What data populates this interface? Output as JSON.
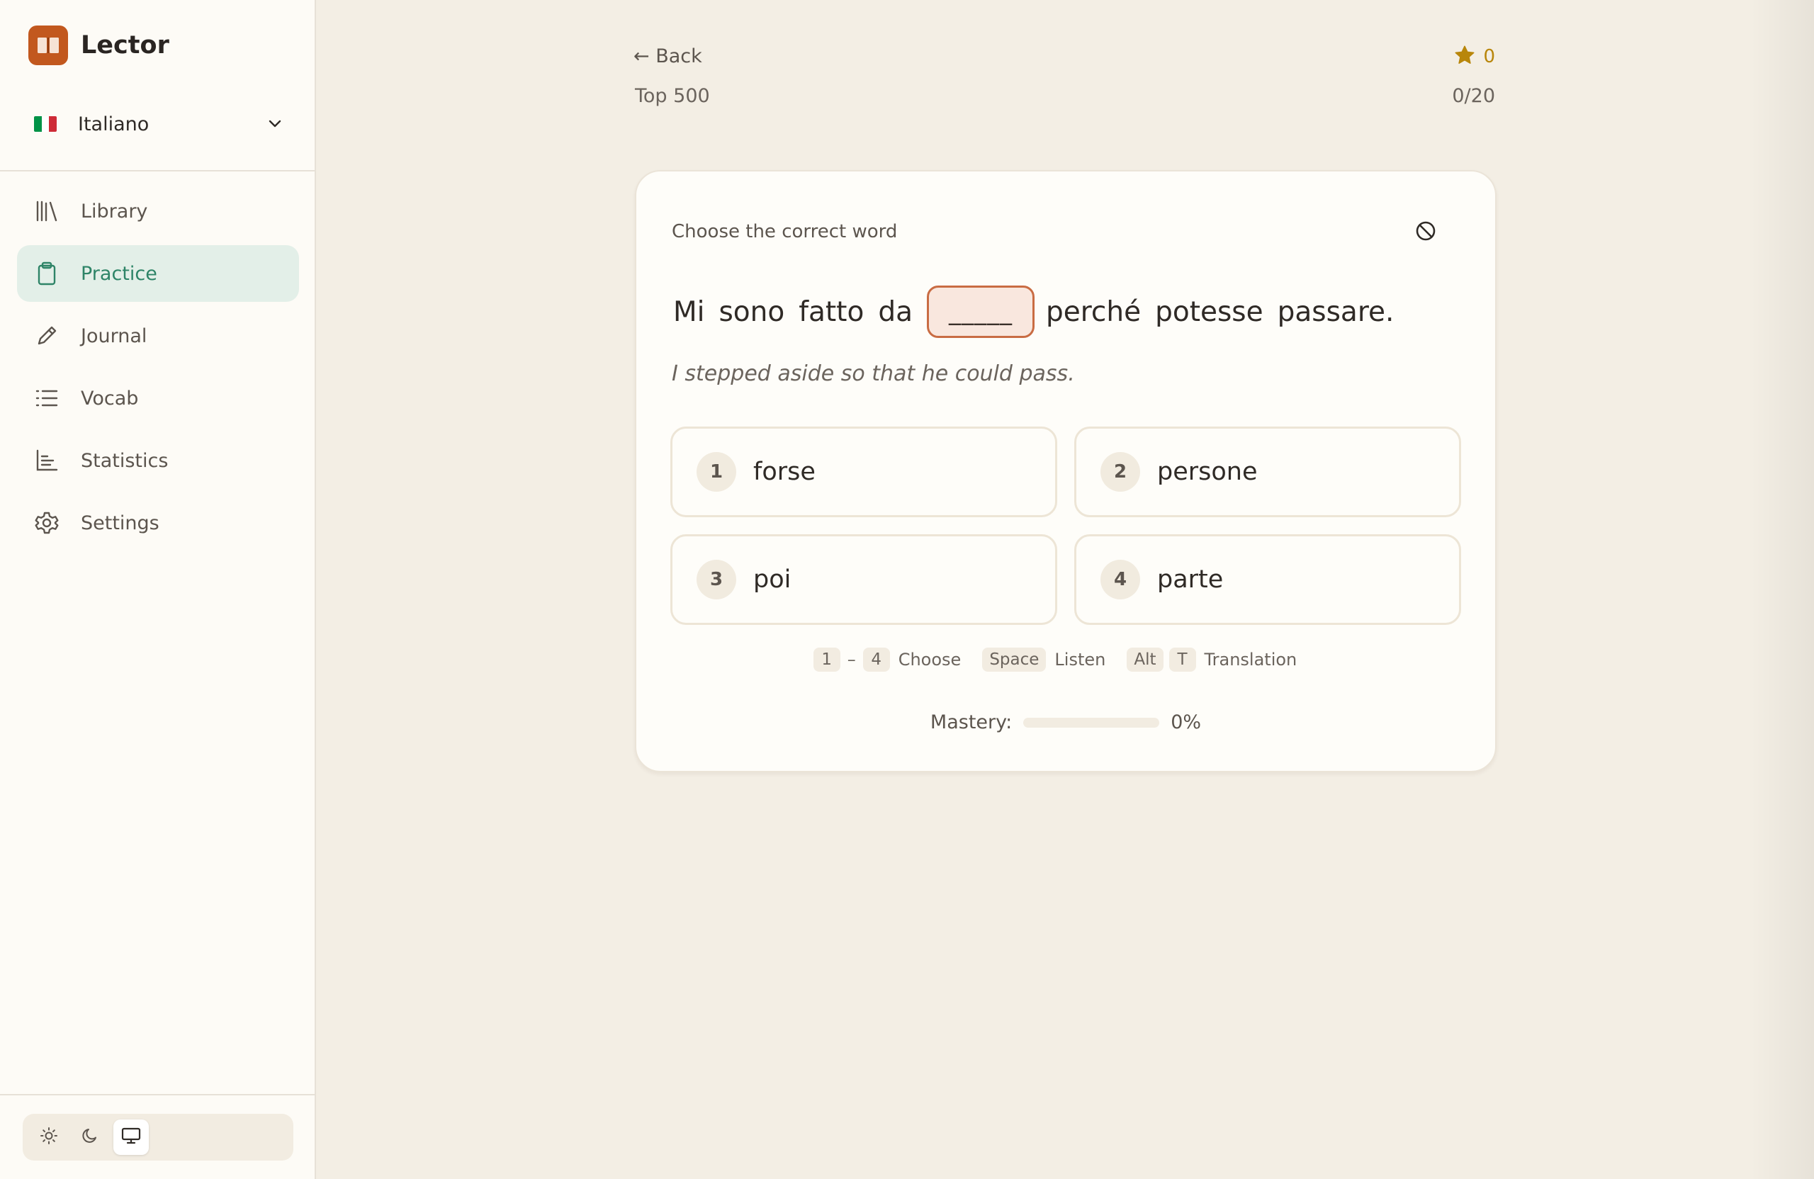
{
  "app": {
    "name": "Lector",
    "accent": "#2e8467",
    "brand_color": "#c2581e"
  },
  "sidebar": {
    "language": {
      "label": "Italiano",
      "flag_colors": [
        "#009246",
        "#ffffff",
        "#ce2b37"
      ]
    },
    "items": [
      {
        "label": "Library",
        "icon": "library-icon"
      },
      {
        "label": "Practice",
        "icon": "clipboard-icon",
        "active": true
      },
      {
        "label": "Journal",
        "icon": "pencil-icon"
      },
      {
        "label": "Vocab",
        "icon": "list-icon"
      },
      {
        "label": "Statistics",
        "icon": "bar-chart-icon"
      },
      {
        "label": "Settings",
        "icon": "gear-icon"
      }
    ],
    "theme": {
      "options": [
        "light",
        "dark",
        "system"
      ],
      "selected": "system"
    }
  },
  "header": {
    "back_label": "← Back",
    "deck": "Top 500",
    "score": "0",
    "progress": "0/20"
  },
  "card": {
    "prompt": "Choose the correct word",
    "sentence_before": [
      "Mi",
      "sono",
      "fatto",
      "da"
    ],
    "blank": "_____",
    "sentence_after": [
      "perché",
      "potesse",
      "passare."
    ],
    "translation": "I stepped aside so that he could pass.",
    "options": [
      {
        "num": "1",
        "label": "forse"
      },
      {
        "num": "2",
        "label": "persone"
      },
      {
        "num": "3",
        "label": "poi"
      },
      {
        "num": "4",
        "label": "parte"
      }
    ],
    "shortcuts": {
      "choose_from": "1",
      "choose_dash": "–",
      "choose_to": "4",
      "choose_label": "Choose",
      "listen_key": "Space",
      "listen_label": "Listen",
      "translation_key1": "Alt",
      "translation_key2": "T",
      "translation_label": "Translation"
    },
    "mastery": {
      "label": "Mastery:",
      "value_text": "0%",
      "value": 0
    }
  }
}
